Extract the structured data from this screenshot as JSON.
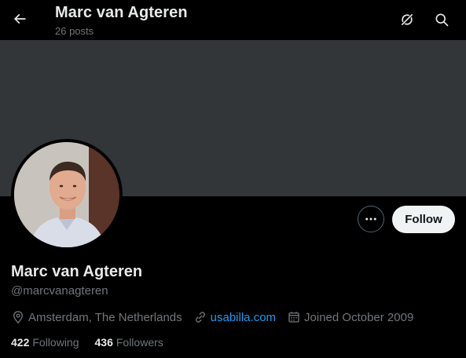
{
  "header": {
    "title": "Marc van Agteren",
    "post_count": "26 posts"
  },
  "icons": {
    "back": "arrow-left-icon",
    "grok": "grok-icon",
    "search": "search-icon",
    "more": "more-horizontal-icon",
    "location": "location-pin-icon",
    "link": "link-icon",
    "calendar": "calendar-icon"
  },
  "profile": {
    "display_name": "Marc van Agteren",
    "handle": "@marcvanagteren",
    "location": "Amsterdam, The Netherlands",
    "website": "usabilla.com",
    "joined": "Joined October 2009"
  },
  "actions": {
    "follow_label": "Follow"
  },
  "stats": {
    "following_count": "422",
    "following_label": "Following",
    "followers_count": "436",
    "followers_label": "Followers"
  },
  "colors": {
    "background": "#000000",
    "banner": "#333639",
    "primary_text": "#e7e9ea",
    "secondary_text": "#71767b",
    "link": "#1d9bf0",
    "follow_button_bg": "#eff3f4"
  }
}
